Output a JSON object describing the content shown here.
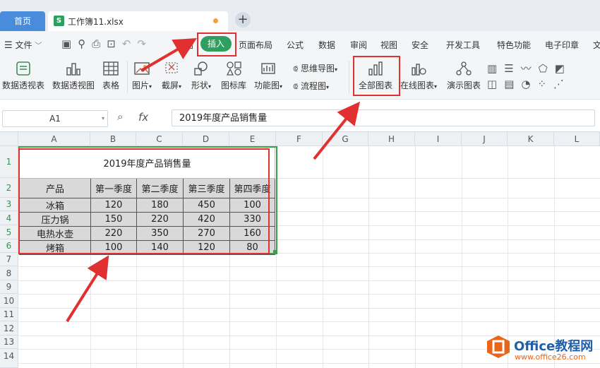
{
  "tabs": {
    "home": "首页",
    "file_icon": "S",
    "file_name": "工作簿11.xlsx"
  },
  "menu": {
    "file": "文件",
    "items": [
      "开始",
      "插入",
      "页面布局",
      "公式",
      "数据",
      "审阅",
      "视图",
      "安全",
      "开发工具",
      "特色功能",
      "电子印章",
      "文"
    ]
  },
  "ribbon": {
    "pivot_table": "数据透视表",
    "pivot_chart": "数据透视图",
    "table": "表格",
    "picture": "图片",
    "screenshot": "截屏",
    "shapes": "形状",
    "icon_lib": "图标库",
    "func_chart": "功能图",
    "mindmap": "思维导图",
    "flowchart": "流程图",
    "all_charts": "全部图表",
    "online_chart": "在线图表",
    "demo_chart": "演示图表"
  },
  "formula_bar": {
    "cell": "A1",
    "fx": "fx",
    "content": "2019年度产品销售量"
  },
  "columns": [
    "A",
    "B",
    "C",
    "D",
    "E",
    "F",
    "G",
    "H",
    "I",
    "J",
    "K",
    "L"
  ],
  "rows": [
    "1",
    "2",
    "3",
    "4",
    "5",
    "6",
    "7",
    "8",
    "9",
    "10",
    "11",
    "12",
    "13",
    "14"
  ],
  "sheet": {
    "title": "2019年度产品销售量",
    "headers": [
      "产品",
      "第一季度",
      "第二季度",
      "第三季度",
      "第四季度"
    ],
    "data": [
      [
        "冰箱",
        "120",
        "180",
        "450",
        "100"
      ],
      [
        "压力锅",
        "150",
        "220",
        "420",
        "330"
      ],
      [
        "电热水壶",
        "220",
        "350",
        "270",
        "160"
      ],
      [
        "烤箱",
        "100",
        "140",
        "120",
        "80"
      ]
    ]
  },
  "watermark": {
    "brand": "Office教程网",
    "url": "www.office26.com"
  },
  "colors": {
    "accent": "#2e9f5e",
    "highlight": "#e03030",
    "home_tab": "#4a8cdc"
  }
}
